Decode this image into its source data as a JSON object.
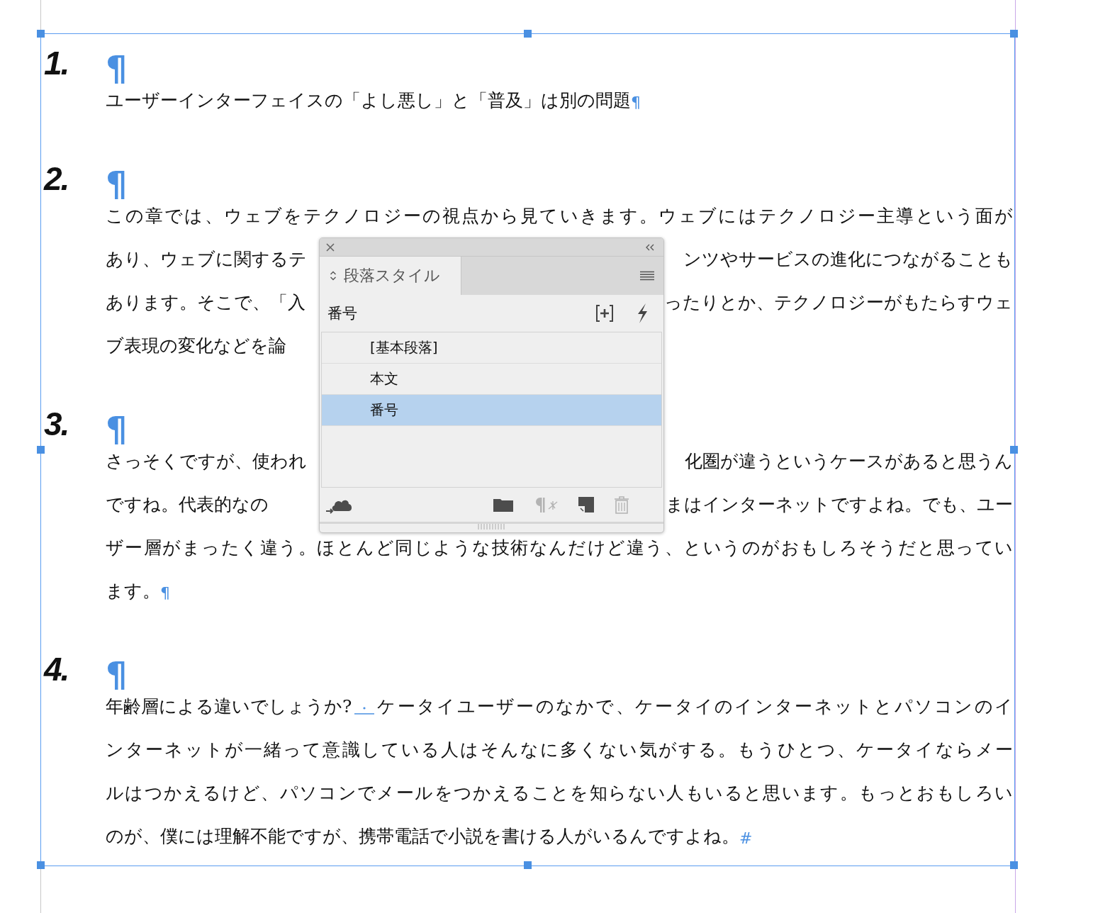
{
  "document": {
    "paragraphs": [
      {
        "number": "1.",
        "pilcrow": "¶",
        "lines": [
          {
            "justify": false,
            "parts": [
              {
                "kind": "text",
                "text": "ユーザーインターフェイスの「よし悪し」と「普及」は別の問題"
              },
              {
                "kind": "end",
                "text": "¶"
              }
            ]
          }
        ]
      },
      {
        "number": "2.",
        "pilcrow": "¶",
        "lines": [
          {
            "justify": true,
            "parts": [
              {
                "kind": "text",
                "text": "この章では、ウェブをテクノロジーの視点から見ていきます。ウェブにはテクノロジー主導という面が"
              }
            ]
          },
          {
            "justify": true,
            "parts": [
              {
                "kind": "text",
                "text": "あり、ウェブに関するテ"
              },
              {
                "kind": "gap"
              },
              {
                "kind": "text",
                "text": "ンツやサービスの進化につながることも"
              }
            ]
          },
          {
            "justify": true,
            "parts": [
              {
                "kind": "text",
                "text": "あります。そこで、「入"
              },
              {
                "kind": "gap"
              },
              {
                "kind": "text",
                "text": "ったりとか、テクノロジーがもたらすウェ"
              }
            ]
          },
          {
            "justify": false,
            "parts": [
              {
                "kind": "text",
                "text": "ブ表現の変化などを論"
              }
            ]
          }
        ]
      },
      {
        "number": "3.",
        "pilcrow": "¶",
        "lines": [
          {
            "justify": true,
            "parts": [
              {
                "kind": "text",
                "text": "さっそくですが、使われ"
              },
              {
                "kind": "gap"
              },
              {
                "kind": "text",
                "text": "化圏が違うというケースがあると思うん"
              }
            ]
          },
          {
            "justify": true,
            "parts": [
              {
                "kind": "text",
                "text": "ですね。代表的なの"
              },
              {
                "kind": "gap"
              },
              {
                "kind": "text",
                "text": "まはインターネットですよね。でも、ユー"
              }
            ]
          },
          {
            "justify": true,
            "parts": [
              {
                "kind": "text",
                "text": "ザー層がまったく違う。ほとんど同じような技術なんだけど違う、というのがおもしろそうだと思ってい"
              }
            ]
          },
          {
            "justify": false,
            "parts": [
              {
                "kind": "text",
                "text": "ます。"
              },
              {
                "kind": "end",
                "text": "¶"
              }
            ]
          }
        ]
      },
      {
        "number": "4.",
        "pilcrow": "¶",
        "lines": [
          {
            "justify": true,
            "parts": [
              {
                "kind": "text",
                "text": "年齢層による違いでしょうか?"
              },
              {
                "kind": "marker"
              },
              {
                "kind": "text",
                "text": "ケータイユーザーのなかで、ケータイのインターネットとパソコンのイ"
              }
            ]
          },
          {
            "justify": true,
            "parts": [
              {
                "kind": "text",
                "text": "ンターネットが一緒って意識している人はそんなに多くない気がする。もうひとつ、ケータイならメー"
              }
            ]
          },
          {
            "justify": true,
            "parts": [
              {
                "kind": "text",
                "text": "ルはつかえるけど、パソコンでメールをつかえることを知らない人もいると思います。もっとおもしろい"
              }
            ]
          },
          {
            "justify": false,
            "parts": [
              {
                "kind": "text",
                "text": "のが、僕には理解不能ですが、携帯電話で小説を書ける人がいるんですよね。"
              },
              {
                "kind": "end",
                "text": "#"
              }
            ]
          }
        ]
      }
    ]
  },
  "panel": {
    "tab": {
      "label": "段落スタイル",
      "selected": true
    },
    "current_style": "番号",
    "styles": [
      {
        "label": "[基本段落]",
        "selected": false
      },
      {
        "label": "本文",
        "selected": false
      },
      {
        "label": "番号",
        "selected": true
      }
    ],
    "footer_buttons": [
      {
        "kind": "library",
        "disabled": false
      },
      {
        "kind": "folder",
        "disabled": false
      },
      {
        "kind": "clear",
        "disabled": true
      },
      {
        "kind": "new",
        "disabled": false
      },
      {
        "kind": "delete",
        "disabled": true
      }
    ]
  }
}
